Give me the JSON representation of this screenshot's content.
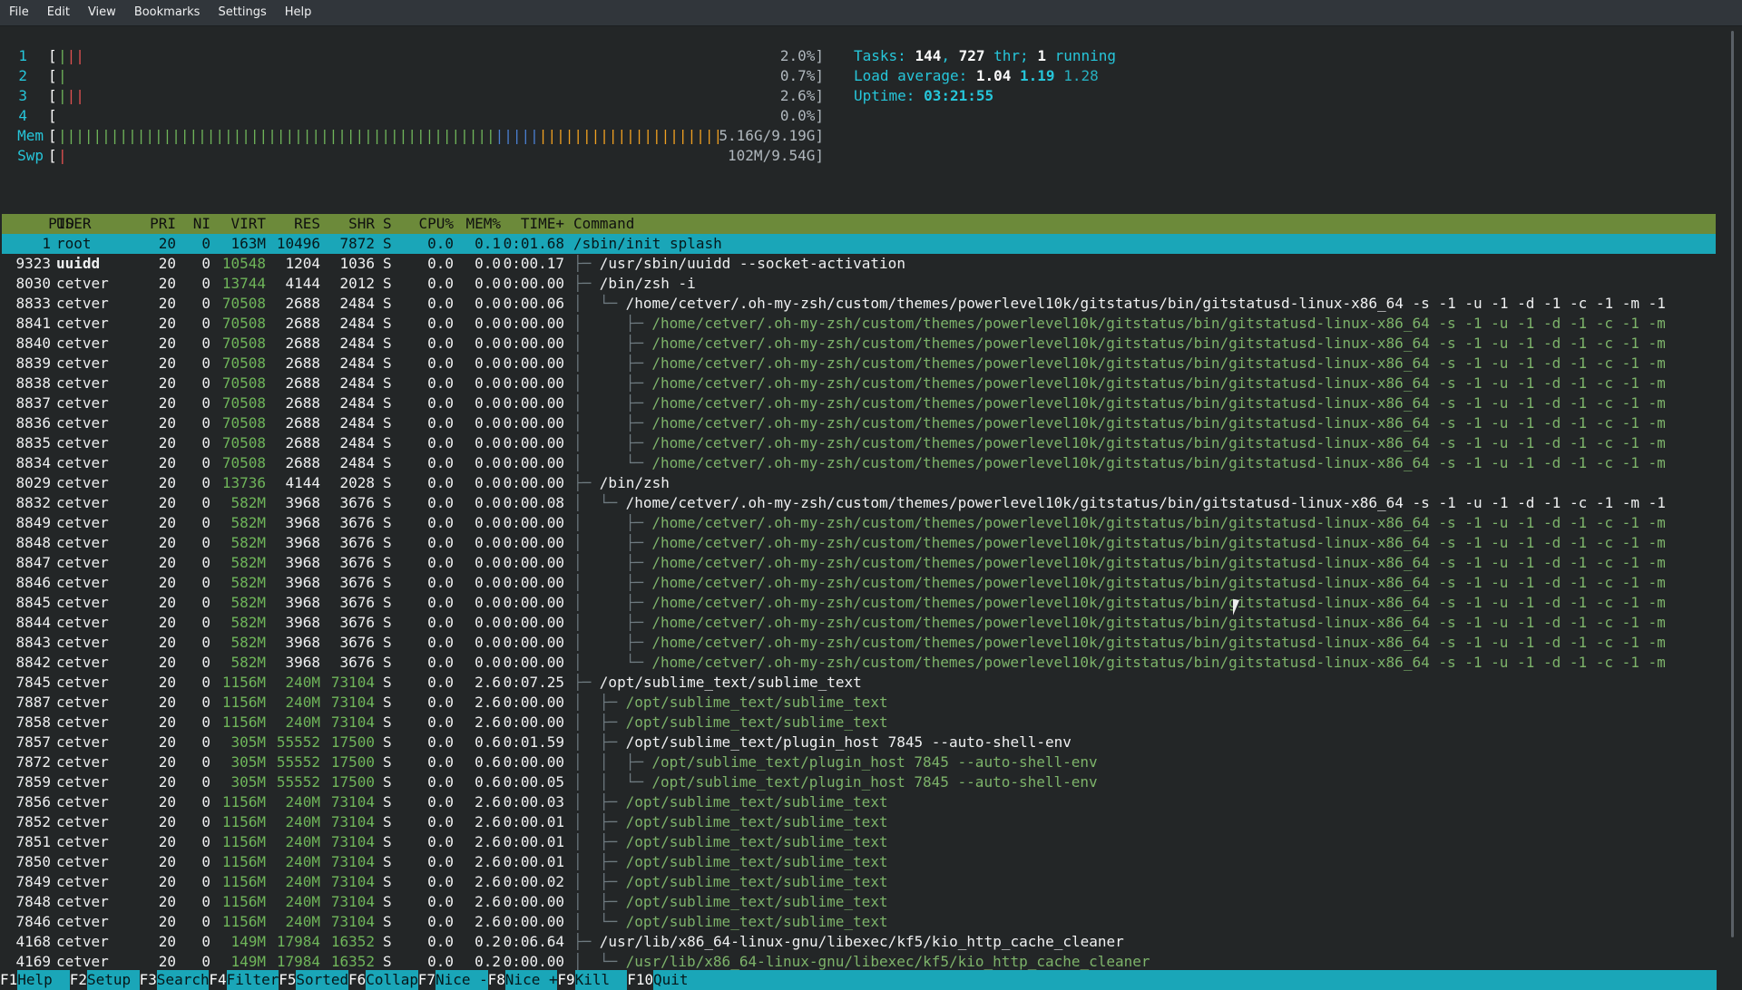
{
  "menubar": [
    "File",
    "Edit",
    "View",
    "Bookmarks",
    "Settings",
    "Help"
  ],
  "meters": [
    {
      "label": "1",
      "bar": "|||",
      "value": "2.0%]"
    },
    {
      "label": "2",
      "bar": "|",
      "value": "0.7%]"
    },
    {
      "label": "3",
      "bar": "|||",
      "value": "2.6%]"
    },
    {
      "label": "4",
      "bar": "",
      "value": "0.0%]"
    },
    {
      "label": "Mem",
      "bar": "||||||||||||||||||||||||||||||||||||||||||||||||||||||||||||||||||||||||||||||||||",
      "value": "5.16G/9.19G]"
    },
    {
      "label": "Swp",
      "bar": "|",
      "value": "102M/9.54G]"
    }
  ],
  "info": {
    "tasks_label": "Tasks: ",
    "tasks": "144",
    "sep1": ", ",
    "threads": "727",
    "thr_label": " thr; ",
    "running": "1",
    "running_label": " running",
    "load_label": "Load average: ",
    "load1": "1.04",
    "load5": "1.19",
    "load15": "1.28",
    "uptime_label": "Uptime: ",
    "uptime": "03:21:55"
  },
  "columns": [
    "PID",
    "USER",
    "PRI",
    "NI",
    "VIRT",
    "RES",
    "SHR",
    "S",
    "CPU%",
    "MEM%",
    "TIME+",
    "Command"
  ],
  "colors": {
    "accent": "#1aa6b8",
    "header_bg": "#6c8a3a",
    "background": "#232627",
    "thread": "#7db36a"
  },
  "processes": [
    {
      "pid": "1",
      "user": "root",
      "pri": "20",
      "ni": "0",
      "virt": "163M",
      "res": "10496",
      "shr": "7872",
      "s": "S",
      "cpu": "0.0",
      "mem": "0.1",
      "time": "0:01.68",
      "tree": "",
      "cmd": "/sbin/init splash",
      "thread": false
    },
    {
      "pid": "9323",
      "user": "uuidd",
      "pri": "20",
      "ni": "0",
      "virt": "10548",
      "res": "1204",
      "shr": "1036",
      "s": "S",
      "cpu": "0.0",
      "mem": "0.0",
      "time": "0:00.17",
      "tree": "├─ ",
      "cmd": "/usr/sbin/uuidd --socket-activation",
      "thread": false
    },
    {
      "pid": "8030",
      "user": "cetver",
      "pri": "20",
      "ni": "0",
      "virt": "13744",
      "res": "4144",
      "shr": "2012",
      "s": "S",
      "cpu": "0.0",
      "mem": "0.0",
      "time": "0:00.00",
      "tree": "├─ ",
      "cmd": "/bin/zsh -i",
      "thread": false
    },
    {
      "pid": "8833",
      "user": "cetver",
      "pri": "20",
      "ni": "0",
      "virt": "70508",
      "res": "2688",
      "shr": "2484",
      "s": "S",
      "cpu": "0.0",
      "mem": "0.0",
      "time": "0:00.06",
      "tree": "│  └─ ",
      "cmd": "/home/cetver/.oh-my-zsh/custom/themes/powerlevel10k/gitstatus/bin/gitstatusd-linux-x86_64 -s -1 -u -1 -d -1 -c -1 -m -1",
      "thread": false
    },
    {
      "pid": "8841",
      "user": "cetver",
      "pri": "20",
      "ni": "0",
      "virt": "70508",
      "res": "2688",
      "shr": "2484",
      "s": "S",
      "cpu": "0.0",
      "mem": "0.0",
      "time": "0:00.00",
      "tree": "│     ├─ ",
      "cmd": "/home/cetver/.oh-my-zsh/custom/themes/powerlevel10k/gitstatus/bin/gitstatusd-linux-x86_64 -s -1 -u -1 -d -1 -c -1 -m",
      "thread": true
    },
    {
      "pid": "8840",
      "user": "cetver",
      "pri": "20",
      "ni": "0",
      "virt": "70508",
      "res": "2688",
      "shr": "2484",
      "s": "S",
      "cpu": "0.0",
      "mem": "0.0",
      "time": "0:00.00",
      "tree": "│     ├─ ",
      "cmd": "/home/cetver/.oh-my-zsh/custom/themes/powerlevel10k/gitstatus/bin/gitstatusd-linux-x86_64 -s -1 -u -1 -d -1 -c -1 -m",
      "thread": true
    },
    {
      "pid": "8839",
      "user": "cetver",
      "pri": "20",
      "ni": "0",
      "virt": "70508",
      "res": "2688",
      "shr": "2484",
      "s": "S",
      "cpu": "0.0",
      "mem": "0.0",
      "time": "0:00.00",
      "tree": "│     ├─ ",
      "cmd": "/home/cetver/.oh-my-zsh/custom/themes/powerlevel10k/gitstatus/bin/gitstatusd-linux-x86_64 -s -1 -u -1 -d -1 -c -1 -m",
      "thread": true
    },
    {
      "pid": "8838",
      "user": "cetver",
      "pri": "20",
      "ni": "0",
      "virt": "70508",
      "res": "2688",
      "shr": "2484",
      "s": "S",
      "cpu": "0.0",
      "mem": "0.0",
      "time": "0:00.00",
      "tree": "│     ├─ ",
      "cmd": "/home/cetver/.oh-my-zsh/custom/themes/powerlevel10k/gitstatus/bin/gitstatusd-linux-x86_64 -s -1 -u -1 -d -1 -c -1 -m",
      "thread": true
    },
    {
      "pid": "8837",
      "user": "cetver",
      "pri": "20",
      "ni": "0",
      "virt": "70508",
      "res": "2688",
      "shr": "2484",
      "s": "S",
      "cpu": "0.0",
      "mem": "0.0",
      "time": "0:00.00",
      "tree": "│     ├─ ",
      "cmd": "/home/cetver/.oh-my-zsh/custom/themes/powerlevel10k/gitstatus/bin/gitstatusd-linux-x86_64 -s -1 -u -1 -d -1 -c -1 -m",
      "thread": true
    },
    {
      "pid": "8836",
      "user": "cetver",
      "pri": "20",
      "ni": "0",
      "virt": "70508",
      "res": "2688",
      "shr": "2484",
      "s": "S",
      "cpu": "0.0",
      "mem": "0.0",
      "time": "0:00.00",
      "tree": "│     ├─ ",
      "cmd": "/home/cetver/.oh-my-zsh/custom/themes/powerlevel10k/gitstatus/bin/gitstatusd-linux-x86_64 -s -1 -u -1 -d -1 -c -1 -m",
      "thread": true
    },
    {
      "pid": "8835",
      "user": "cetver",
      "pri": "20",
      "ni": "0",
      "virt": "70508",
      "res": "2688",
      "shr": "2484",
      "s": "S",
      "cpu": "0.0",
      "mem": "0.0",
      "time": "0:00.00",
      "tree": "│     ├─ ",
      "cmd": "/home/cetver/.oh-my-zsh/custom/themes/powerlevel10k/gitstatus/bin/gitstatusd-linux-x86_64 -s -1 -u -1 -d -1 -c -1 -m",
      "thread": true
    },
    {
      "pid": "8834",
      "user": "cetver",
      "pri": "20",
      "ni": "0",
      "virt": "70508",
      "res": "2688",
      "shr": "2484",
      "s": "S",
      "cpu": "0.0",
      "mem": "0.0",
      "time": "0:00.00",
      "tree": "│     └─ ",
      "cmd": "/home/cetver/.oh-my-zsh/custom/themes/powerlevel10k/gitstatus/bin/gitstatusd-linux-x86_64 -s -1 -u -1 -d -1 -c -1 -m",
      "thread": true
    },
    {
      "pid": "8029",
      "user": "cetver",
      "pri": "20",
      "ni": "0",
      "virt": "13736",
      "res": "4144",
      "shr": "2028",
      "s": "S",
      "cpu": "0.0",
      "mem": "0.0",
      "time": "0:00.00",
      "tree": "├─ ",
      "cmd": "/bin/zsh",
      "thread": false
    },
    {
      "pid": "8832",
      "user": "cetver",
      "pri": "20",
      "ni": "0",
      "virt": "582M",
      "res": "3968",
      "shr": "3676",
      "s": "S",
      "cpu": "0.0",
      "mem": "0.0",
      "time": "0:00.08",
      "tree": "│  └─ ",
      "cmd": "/home/cetver/.oh-my-zsh/custom/themes/powerlevel10k/gitstatus/bin/gitstatusd-linux-x86_64 -s -1 -u -1 -d -1 -c -1 -m -1",
      "thread": false
    },
    {
      "pid": "8849",
      "user": "cetver",
      "pri": "20",
      "ni": "0",
      "virt": "582M",
      "res": "3968",
      "shr": "3676",
      "s": "S",
      "cpu": "0.0",
      "mem": "0.0",
      "time": "0:00.00",
      "tree": "│     ├─ ",
      "cmd": "/home/cetver/.oh-my-zsh/custom/themes/powerlevel10k/gitstatus/bin/gitstatusd-linux-x86_64 -s -1 -u -1 -d -1 -c -1 -m",
      "thread": true
    },
    {
      "pid": "8848",
      "user": "cetver",
      "pri": "20",
      "ni": "0",
      "virt": "582M",
      "res": "3968",
      "shr": "3676",
      "s": "S",
      "cpu": "0.0",
      "mem": "0.0",
      "time": "0:00.00",
      "tree": "│     ├─ ",
      "cmd": "/home/cetver/.oh-my-zsh/custom/themes/powerlevel10k/gitstatus/bin/gitstatusd-linux-x86_64 -s -1 -u -1 -d -1 -c -1 -m",
      "thread": true
    },
    {
      "pid": "8847",
      "user": "cetver",
      "pri": "20",
      "ni": "0",
      "virt": "582M",
      "res": "3968",
      "shr": "3676",
      "s": "S",
      "cpu": "0.0",
      "mem": "0.0",
      "time": "0:00.00",
      "tree": "│     ├─ ",
      "cmd": "/home/cetver/.oh-my-zsh/custom/themes/powerlevel10k/gitstatus/bin/gitstatusd-linux-x86_64 -s -1 -u -1 -d -1 -c -1 -m",
      "thread": true
    },
    {
      "pid": "8846",
      "user": "cetver",
      "pri": "20",
      "ni": "0",
      "virt": "582M",
      "res": "3968",
      "shr": "3676",
      "s": "S",
      "cpu": "0.0",
      "mem": "0.0",
      "time": "0:00.00",
      "tree": "│     ├─ ",
      "cmd": "/home/cetver/.oh-my-zsh/custom/themes/powerlevel10k/gitstatus/bin/gitstatusd-linux-x86_64 -s -1 -u -1 -d -1 -c -1 -m",
      "thread": true
    },
    {
      "pid": "8845",
      "user": "cetver",
      "pri": "20",
      "ni": "0",
      "virt": "582M",
      "res": "3968",
      "shr": "3676",
      "s": "S",
      "cpu": "0.0",
      "mem": "0.0",
      "time": "0:00.00",
      "tree": "│     ├─ ",
      "cmd": "/home/cetver/.oh-my-zsh/custom/themes/powerlevel10k/gitstatus/bin/gitstatusd-linux-x86_64 -s -1 -u -1 -d -1 -c -1 -m",
      "thread": true
    },
    {
      "pid": "8844",
      "user": "cetver",
      "pri": "20",
      "ni": "0",
      "virt": "582M",
      "res": "3968",
      "shr": "3676",
      "s": "S",
      "cpu": "0.0",
      "mem": "0.0",
      "time": "0:00.00",
      "tree": "│     ├─ ",
      "cmd": "/home/cetver/.oh-my-zsh/custom/themes/powerlevel10k/gitstatus/bin/gitstatusd-linux-x86_64 -s -1 -u -1 -d -1 -c -1 -m",
      "thread": true
    },
    {
      "pid": "8843",
      "user": "cetver",
      "pri": "20",
      "ni": "0",
      "virt": "582M",
      "res": "3968",
      "shr": "3676",
      "s": "S",
      "cpu": "0.0",
      "mem": "0.0",
      "time": "0:00.00",
      "tree": "│     ├─ ",
      "cmd": "/home/cetver/.oh-my-zsh/custom/themes/powerlevel10k/gitstatus/bin/gitstatusd-linux-x86_64 -s -1 -u -1 -d -1 -c -1 -m",
      "thread": true
    },
    {
      "pid": "8842",
      "user": "cetver",
      "pri": "20",
      "ni": "0",
      "virt": "582M",
      "res": "3968",
      "shr": "3676",
      "s": "S",
      "cpu": "0.0",
      "mem": "0.0",
      "time": "0:00.00",
      "tree": "│     └─ ",
      "cmd": "/home/cetver/.oh-my-zsh/custom/themes/powerlevel10k/gitstatus/bin/gitstatusd-linux-x86_64 -s -1 -u -1 -d -1 -c -1 -m",
      "thread": true
    },
    {
      "pid": "7845",
      "user": "cetver",
      "pri": "20",
      "ni": "0",
      "virt": "1156M",
      "res": "240M",
      "shr": "73104",
      "s": "S",
      "cpu": "0.0",
      "mem": "2.6",
      "time": "0:07.25",
      "tree": "├─ ",
      "cmd": "/opt/sublime_text/sublime_text",
      "thread": false
    },
    {
      "pid": "7887",
      "user": "cetver",
      "pri": "20",
      "ni": "0",
      "virt": "1156M",
      "res": "240M",
      "shr": "73104",
      "s": "S",
      "cpu": "0.0",
      "mem": "2.6",
      "time": "0:00.00",
      "tree": "│  ├─ ",
      "cmd": "/opt/sublime_text/sublime_text",
      "thread": true
    },
    {
      "pid": "7858",
      "user": "cetver",
      "pri": "20",
      "ni": "0",
      "virt": "1156M",
      "res": "240M",
      "shr": "73104",
      "s": "S",
      "cpu": "0.0",
      "mem": "2.6",
      "time": "0:00.00",
      "tree": "│  ├─ ",
      "cmd": "/opt/sublime_text/sublime_text",
      "thread": true
    },
    {
      "pid": "7857",
      "user": "cetver",
      "pri": "20",
      "ni": "0",
      "virt": "305M",
      "res": "55552",
      "shr": "17500",
      "s": "S",
      "cpu": "0.0",
      "mem": "0.6",
      "time": "0:01.59",
      "tree": "│  ├─ ",
      "cmd": "/opt/sublime_text/plugin_host 7845 --auto-shell-env",
      "thread": false
    },
    {
      "pid": "7872",
      "user": "cetver",
      "pri": "20",
      "ni": "0",
      "virt": "305M",
      "res": "55552",
      "shr": "17500",
      "s": "S",
      "cpu": "0.0",
      "mem": "0.6",
      "time": "0:00.00",
      "tree": "│  │  ├─ ",
      "cmd": "/opt/sublime_text/plugin_host 7845 --auto-shell-env",
      "thread": true
    },
    {
      "pid": "7859",
      "user": "cetver",
      "pri": "20",
      "ni": "0",
      "virt": "305M",
      "res": "55552",
      "shr": "17500",
      "s": "S",
      "cpu": "0.0",
      "mem": "0.6",
      "time": "0:00.05",
      "tree": "│  │  └─ ",
      "cmd": "/opt/sublime_text/plugin_host 7845 --auto-shell-env",
      "thread": true
    },
    {
      "pid": "7856",
      "user": "cetver",
      "pri": "20",
      "ni": "0",
      "virt": "1156M",
      "res": "240M",
      "shr": "73104",
      "s": "S",
      "cpu": "0.0",
      "mem": "2.6",
      "time": "0:00.03",
      "tree": "│  ├─ ",
      "cmd": "/opt/sublime_text/sublime_text",
      "thread": true
    },
    {
      "pid": "7852",
      "user": "cetver",
      "pri": "20",
      "ni": "0",
      "virt": "1156M",
      "res": "240M",
      "shr": "73104",
      "s": "S",
      "cpu": "0.0",
      "mem": "2.6",
      "time": "0:00.01",
      "tree": "│  ├─ ",
      "cmd": "/opt/sublime_text/sublime_text",
      "thread": true
    },
    {
      "pid": "7851",
      "user": "cetver",
      "pri": "20",
      "ni": "0",
      "virt": "1156M",
      "res": "240M",
      "shr": "73104",
      "s": "S",
      "cpu": "0.0",
      "mem": "2.6",
      "time": "0:00.01",
      "tree": "│  ├─ ",
      "cmd": "/opt/sublime_text/sublime_text",
      "thread": true
    },
    {
      "pid": "7850",
      "user": "cetver",
      "pri": "20",
      "ni": "0",
      "virt": "1156M",
      "res": "240M",
      "shr": "73104",
      "s": "S",
      "cpu": "0.0",
      "mem": "2.6",
      "time": "0:00.01",
      "tree": "│  ├─ ",
      "cmd": "/opt/sublime_text/sublime_text",
      "thread": true
    },
    {
      "pid": "7849",
      "user": "cetver",
      "pri": "20",
      "ni": "0",
      "virt": "1156M",
      "res": "240M",
      "shr": "73104",
      "s": "S",
      "cpu": "0.0",
      "mem": "2.6",
      "time": "0:00.02",
      "tree": "│  ├─ ",
      "cmd": "/opt/sublime_text/sublime_text",
      "thread": true
    },
    {
      "pid": "7848",
      "user": "cetver",
      "pri": "20",
      "ni": "0",
      "virt": "1156M",
      "res": "240M",
      "shr": "73104",
      "s": "S",
      "cpu": "0.0",
      "mem": "2.6",
      "time": "0:00.00",
      "tree": "│  ├─ ",
      "cmd": "/opt/sublime_text/sublime_text",
      "thread": true
    },
    {
      "pid": "7846",
      "user": "cetver",
      "pri": "20",
      "ni": "0",
      "virt": "1156M",
      "res": "240M",
      "shr": "73104",
      "s": "S",
      "cpu": "0.0",
      "mem": "2.6",
      "time": "0:00.00",
      "tree": "│  └─ ",
      "cmd": "/opt/sublime_text/sublime_text",
      "thread": true
    },
    {
      "pid": "4168",
      "user": "cetver",
      "pri": "20",
      "ni": "0",
      "virt": "149M",
      "res": "17984",
      "shr": "16352",
      "s": "S",
      "cpu": "0.0",
      "mem": "0.2",
      "time": "0:06.64",
      "tree": "├─ ",
      "cmd": "/usr/lib/x86_64-linux-gnu/libexec/kf5/kio_http_cache_cleaner",
      "thread": false
    },
    {
      "pid": "4169",
      "user": "cetver",
      "pri": "20",
      "ni": "0",
      "virt": "149M",
      "res": "17984",
      "shr": "16352",
      "s": "S",
      "cpu": "0.0",
      "mem": "0.2",
      "time": "0:00.00",
      "tree": "│  └─ ",
      "cmd": "/usr/lib/x86_64-linux-gnu/libexec/kf5/kio_http_cache_cleaner",
      "thread": true
    }
  ],
  "footer": [
    {
      "key": "F1",
      "label": "Help  "
    },
    {
      "key": "F2",
      "label": "Setup "
    },
    {
      "key": "F3",
      "label": "Search"
    },
    {
      "key": "F4",
      "label": "Filter"
    },
    {
      "key": "F5",
      "label": "Sorted"
    },
    {
      "key": "F6",
      "label": "Collap"
    },
    {
      "key": "F7",
      "label": "Nice -"
    },
    {
      "key": "F8",
      "label": "Nice +"
    },
    {
      "key": "F9",
      "label": "Kill  "
    },
    {
      "key": "F10",
      "label": "Quit  "
    }
  ]
}
